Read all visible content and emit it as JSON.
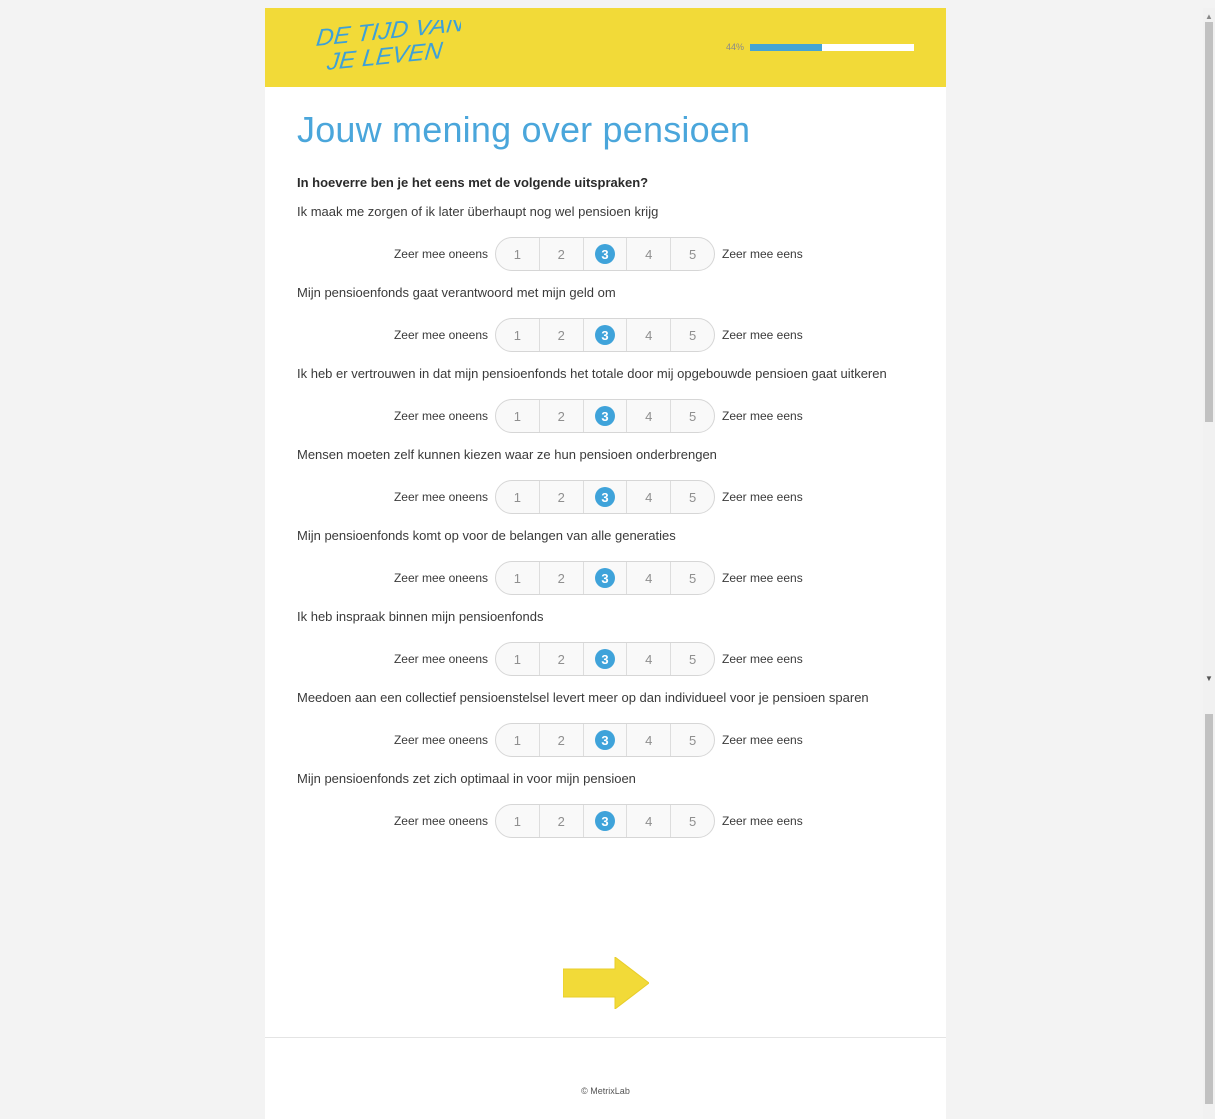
{
  "header": {
    "logo_line1": "DE TIJD VAN",
    "logo_line2": "JE LEVEN",
    "progress_text": "44%",
    "progress_value": 44,
    "brand_color": "#f2da38",
    "accent_color": "#44a4d5"
  },
  "main": {
    "title": "Jouw mening over pensioen",
    "instruction": "In hoeverre ben je het eens met de volgende uitspraken?",
    "scale_left_label": "Zeer mee oneens",
    "scale_right_label": "Zeer mee eens",
    "scale_options": [
      "1",
      "2",
      "3",
      "4",
      "5"
    ],
    "questions": [
      {
        "text": "Ik maak me zorgen of ik later überhaupt nog wel pensioen krijg",
        "selected": "3"
      },
      {
        "text": "Mijn pensioenfonds gaat verantwoord met mijn geld om",
        "selected": "3"
      },
      {
        "text": "Ik heb er vertrouwen in dat mijn pensioenfonds het totale door mij opgebouwde pensioen gaat uitkeren",
        "selected": "3"
      },
      {
        "text": "Mensen moeten zelf kunnen kiezen waar ze hun pensioen onderbrengen",
        "selected": "3"
      },
      {
        "text": "Mijn pensioenfonds komt op voor de belangen van alle generaties",
        "selected": "3"
      },
      {
        "text": "Ik heb inspraak binnen mijn pensioenfonds",
        "selected": "3"
      },
      {
        "text": "Meedoen aan een collectief pensioenstelsel levert meer op dan individueel voor je pensioen sparen",
        "selected": "3"
      },
      {
        "text": "Mijn pensioenfonds zet zich optimaal in voor mijn pensioen",
        "selected": "3"
      }
    ],
    "next_icon": "arrow-right-icon"
  },
  "footer": {
    "copyright": "© MetrixLab"
  }
}
